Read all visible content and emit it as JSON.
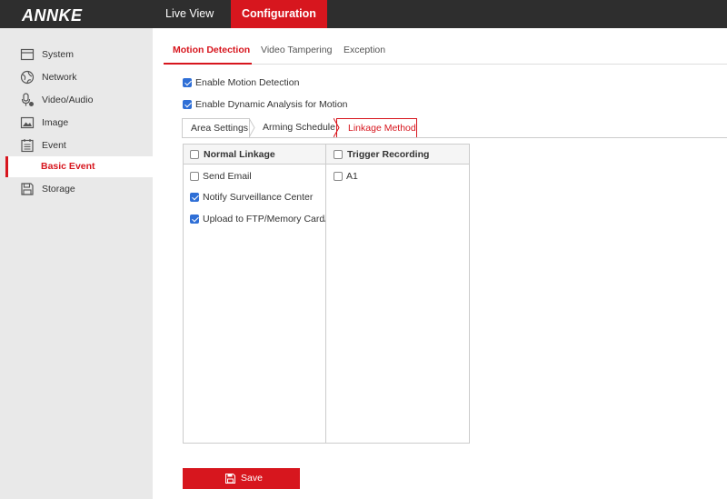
{
  "header": {
    "logo": "ANNKE",
    "nav": [
      "Live View",
      "Configuration"
    ]
  },
  "sidebar": {
    "items": [
      {
        "label": "System",
        "icon": "system-icon"
      },
      {
        "label": "Network",
        "icon": "network-icon"
      },
      {
        "label": "Video/Audio",
        "icon": "video-audio-icon"
      },
      {
        "label": "Image",
        "icon": "image-icon"
      },
      {
        "label": "Event",
        "icon": "event-icon"
      },
      {
        "label": "Storage",
        "icon": "storage-icon"
      }
    ],
    "sub_item": "Basic Event"
  },
  "tabs": [
    "Motion Detection",
    "Video Tampering",
    "Exception"
  ],
  "options": {
    "enable_motion": {
      "label": "Enable Motion Detection",
      "checked": true
    },
    "enable_dynamic": {
      "label": "Enable Dynamic Analysis for Motion",
      "checked": true
    }
  },
  "subtabs": [
    "Area Settings",
    "Arming Schedule",
    "Linkage Method"
  ],
  "normal_linkage": {
    "title": "Normal Linkage",
    "items": [
      {
        "label": "Send Email",
        "checked": false
      },
      {
        "label": "Notify Surveillance Center",
        "checked": true
      },
      {
        "label": "Upload to FTP/Memory Card/...",
        "checked": true
      }
    ]
  },
  "trigger_recording": {
    "title": "Trigger Recording",
    "items": [
      {
        "label": "A1",
        "checked": false
      }
    ]
  },
  "save_label": "Save",
  "accent_color": "#d7161e",
  "checkbox_color": "#2f6fd6"
}
